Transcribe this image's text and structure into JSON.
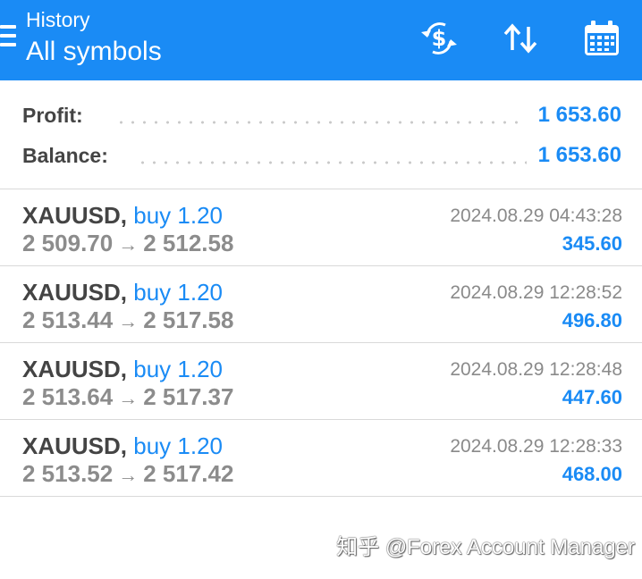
{
  "header": {
    "subtitle": "History",
    "title": "All symbols",
    "icons": [
      "menu-icon",
      "currency-exchange-icon",
      "sort-icon",
      "calendar-icon"
    ]
  },
  "summary": {
    "profit_label": "Profit:",
    "profit_value": "1 653.60",
    "balance_label": "Balance:",
    "balance_value": "1 653.60"
  },
  "trades": [
    {
      "symbol": "XAUUSD",
      "separator": ",",
      "type": "buy 1.20",
      "time": "2024.08.29 04:43:28",
      "open": "2 509.70",
      "arrow": "→",
      "close": "2 512.58",
      "profit": "345.60"
    },
    {
      "symbol": "XAUUSD",
      "separator": ",",
      "type": "buy 1.20",
      "time": "2024.08.29 12:28:52",
      "open": "2 513.44",
      "arrow": "→",
      "close": "2 517.58",
      "profit": "496.80"
    },
    {
      "symbol": "XAUUSD",
      "separator": ",",
      "type": "buy 1.20",
      "time": "2024.08.29 12:28:48",
      "open": "2 513.64",
      "arrow": "→",
      "close": "2 517.37",
      "profit": "447.60"
    },
    {
      "symbol": "XAUUSD",
      "separator": ",",
      "type": "buy 1.20",
      "time": "2024.08.29 12:28:33",
      "open": "2 513.52",
      "arrow": "→",
      "close": "2 517.42",
      "profit": "468.00"
    }
  ],
  "watermark": "知乎 @Forex Account Manager",
  "colors": {
    "accent": "#1a8bf5",
    "text_dark": "#444444",
    "text_muted": "#8c8c8c"
  }
}
